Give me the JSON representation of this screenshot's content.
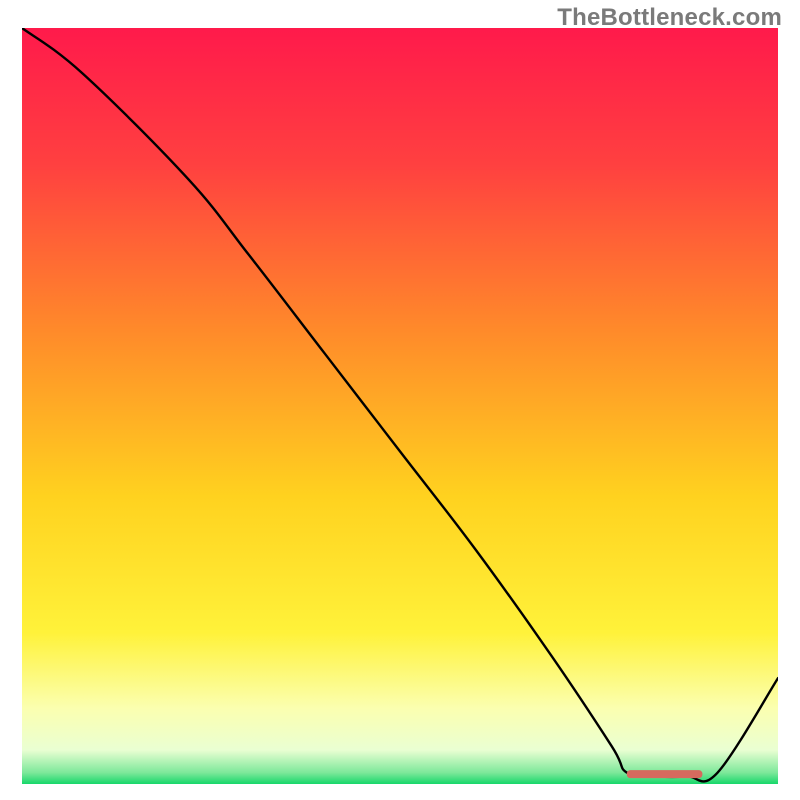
{
  "watermark": "TheBottleneck.com",
  "chart_data": {
    "type": "line",
    "title": "",
    "xlabel": "",
    "ylabel": "",
    "xlim": [
      0,
      100
    ],
    "ylim": [
      0,
      100
    ],
    "grid": false,
    "series": [
      {
        "name": "curve",
        "x": [
          0,
          8,
          22,
          30,
          40,
          50,
          60,
          70,
          78,
          80,
          84,
          88,
          92,
          100
        ],
        "values": [
          100,
          94,
          80,
          70,
          57,
          44,
          31,
          17,
          5,
          1.5,
          1,
          1,
          1.5,
          14
        ]
      }
    ],
    "valley_marker": {
      "x_start": 80,
      "x_end": 90,
      "y": 1.3,
      "color": "#d66a5e"
    },
    "gradient_stops": [
      {
        "offset": 0.0,
        "color": "#ff1a4b"
      },
      {
        "offset": 0.18,
        "color": "#ff4040"
      },
      {
        "offset": 0.4,
        "color": "#ff8a2a"
      },
      {
        "offset": 0.62,
        "color": "#ffd21f"
      },
      {
        "offset": 0.8,
        "color": "#fff23a"
      },
      {
        "offset": 0.9,
        "color": "#fbffb0"
      },
      {
        "offset": 0.955,
        "color": "#eaffd2"
      },
      {
        "offset": 0.985,
        "color": "#7de89a"
      },
      {
        "offset": 1.0,
        "color": "#17d76a"
      }
    ],
    "line_color": "#000000",
    "line_width": 2.4
  }
}
